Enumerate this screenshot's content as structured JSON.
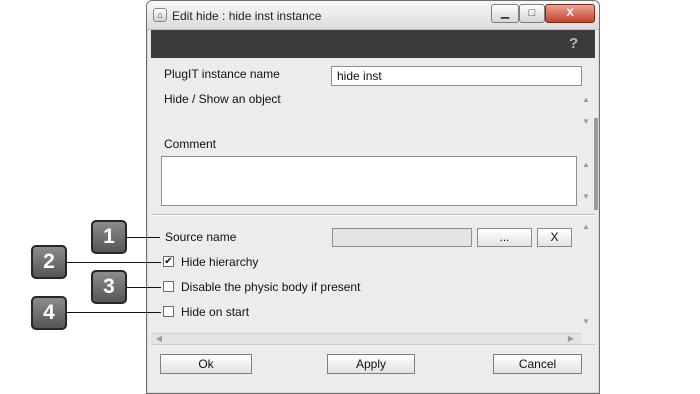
{
  "window": {
    "title": "Edit hide : hide inst instance",
    "help_glyph": "?",
    "minimize_glyph": "▁",
    "maximize_glyph": "□",
    "close_glyph": "X"
  },
  "instance": {
    "name_label": "PlugIT instance name",
    "name_value": "hide inst",
    "description": "Hide / Show an object",
    "comment_label": "Comment",
    "comment_value": ""
  },
  "params": {
    "source_label": "Source name",
    "source_value": "",
    "browse_label": "...",
    "clear_label": "X",
    "options": [
      {
        "label": "Hide hierarchy",
        "checked": true
      },
      {
        "label": "Disable the physic body if present",
        "checked": false
      },
      {
        "label": "Hide on start",
        "checked": false
      }
    ]
  },
  "footer": {
    "ok_label": "Ok",
    "apply_label": "Apply",
    "cancel_label": "Cancel"
  },
  "callouts": [
    "1",
    "2",
    "3",
    "4"
  ],
  "colors": {
    "dark_bar": "#3b3b3b",
    "panel": "#ececec",
    "close_button": "#c4412b"
  }
}
